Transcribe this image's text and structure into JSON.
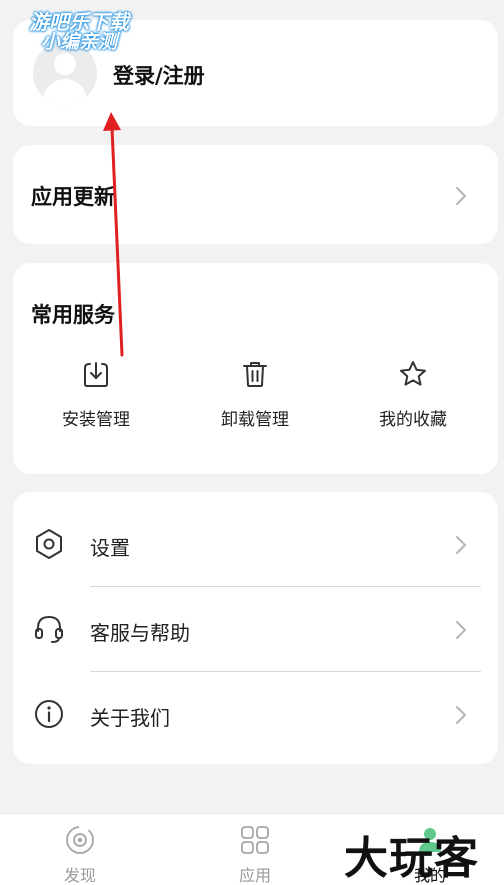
{
  "login": {
    "label": "登录/注册"
  },
  "update": {
    "label": "应用更新"
  },
  "services": {
    "title": "常用服务",
    "items": [
      {
        "label": "安装管理",
        "icon": "download-box-icon"
      },
      {
        "label": "卸载管理",
        "icon": "trash-icon"
      },
      {
        "label": "我的收藏",
        "icon": "star-icon"
      }
    ]
  },
  "settings": {
    "items": [
      {
        "label": "设置",
        "icon": "hexagon-settings-icon"
      },
      {
        "label": "客服与帮助",
        "icon": "headset-icon"
      },
      {
        "label": "关于我们",
        "icon": "info-icon"
      }
    ]
  },
  "nav": {
    "items": [
      {
        "label": "发现",
        "icon": "discover-icon"
      },
      {
        "label": "应用",
        "icon": "apps-grid-icon"
      },
      {
        "label": "我的",
        "icon": "profile-icon"
      }
    ]
  },
  "watermarks": {
    "top_line1": "游吧乐下载",
    "top_line2": "小编亲测",
    "bottom": "大玩客"
  },
  "colors": {
    "background": "#f2f2f2",
    "card": "#ffffff",
    "arrow": "#e02020",
    "watermark_outline": "#1d8fe0",
    "nav_inactive": "#9a9a9a",
    "nav_active_accent": "#5ec98a"
  }
}
